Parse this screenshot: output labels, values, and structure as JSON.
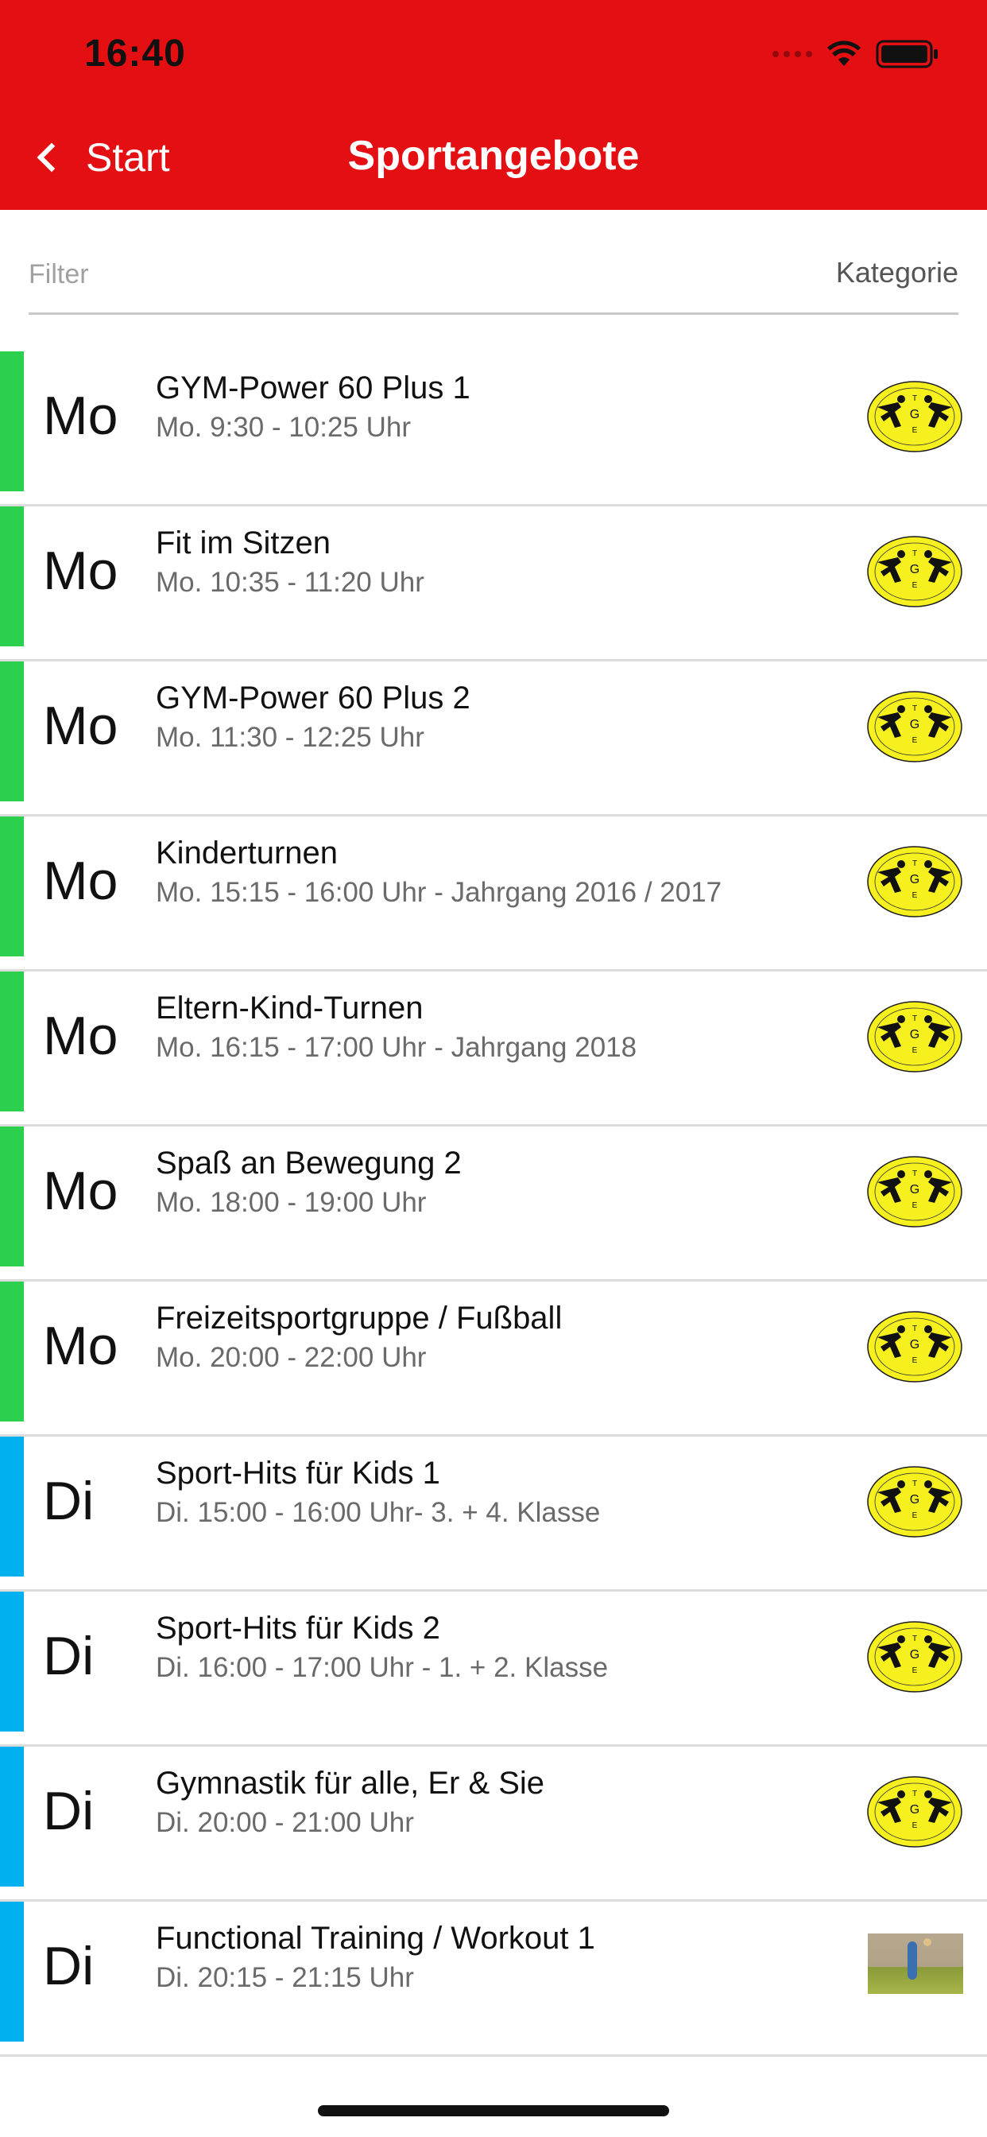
{
  "status": {
    "time": "16:40"
  },
  "nav": {
    "back_label": "Start",
    "title": "Sportangebote"
  },
  "filter": {
    "placeholder": "Filter",
    "value": "",
    "category_label": "Kategorie"
  },
  "colors": {
    "header": "#e30f13",
    "monday": "#2bd04f",
    "tuesday": "#00b0ef"
  },
  "items": [
    {
      "day": "Mo",
      "title": "GYM-Power 60 Plus 1",
      "subtitle": "Mo. 9:30 - 10:25 Uhr",
      "color": "#2bd04f",
      "thumb": "club-logo-icon"
    },
    {
      "day": "Mo",
      "title": "Fit im Sitzen",
      "subtitle": "Mo. 10:35 - 11:20 Uhr",
      "color": "#2bd04f",
      "thumb": "club-logo-icon"
    },
    {
      "day": "Mo",
      "title": "GYM-Power 60 Plus 2",
      "subtitle": "Mo. 11:30 - 12:25 Uhr",
      "color": "#2bd04f",
      "thumb": "club-logo-icon"
    },
    {
      "day": "Mo",
      "title": "Kinderturnen",
      "subtitle": "Mo. 15:15 - 16:00 Uhr - Jahrgang 2016 / 2017",
      "color": "#2bd04f",
      "thumb": "club-logo-icon"
    },
    {
      "day": "Mo",
      "title": "Eltern-Kind-Turnen",
      "subtitle": "Mo. 16:15 - 17:00 Uhr - Jahrgang 2018",
      "color": "#2bd04f",
      "thumb": "club-logo-icon"
    },
    {
      "day": "Mo",
      "title": "Spaß an Bewegung 2",
      "subtitle": "Mo. 18:00 - 19:00 Uhr",
      "color": "#2bd04f",
      "thumb": "club-logo-icon"
    },
    {
      "day": "Mo",
      "title": "Freizeitsportgruppe / Fußball",
      "subtitle": "Mo. 20:00 - 22:00 Uhr",
      "color": "#2bd04f",
      "thumb": "club-logo-icon"
    },
    {
      "day": "Di",
      "title": "Sport-Hits für Kids 1",
      "subtitle": "Di. 15:00 - 16:00 Uhr- 3. + 4. Klasse",
      "color": "#00b0ef",
      "thumb": "club-logo-icon"
    },
    {
      "day": "Di",
      "title": "Sport-Hits für Kids 2",
      "subtitle": "Di. 16:00 - 17:00 Uhr - 1. + 2. Klasse",
      "color": "#00b0ef",
      "thumb": "club-logo-icon"
    },
    {
      "day": "Di",
      "title": "Gymnastik für alle, Er & Sie",
      "subtitle": "Di. 20:00 - 21:00 Uhr",
      "color": "#00b0ef",
      "thumb": "club-logo-icon"
    },
    {
      "day": "Di",
      "title": "Functional Training / Workout 1",
      "subtitle": "Di. 20:15 - 21:15 Uhr",
      "color": "#00b0ef",
      "thumb": "workout-photo"
    }
  ]
}
